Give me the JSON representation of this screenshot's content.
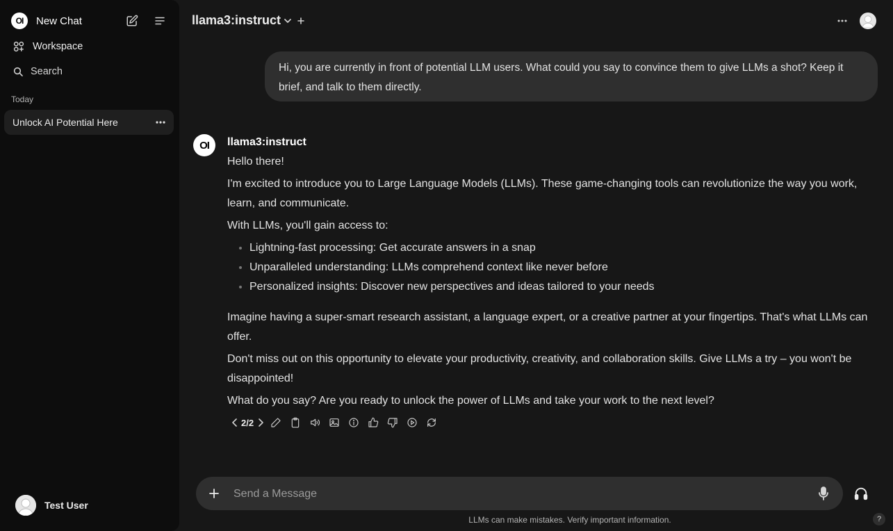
{
  "sidebar": {
    "logo_text": "OI",
    "new_chat_label": "New Chat",
    "workspace_label": "Workspace",
    "search_label": "Search",
    "section_today": "Today",
    "chats": [
      {
        "title": "Unlock AI Potential Here"
      }
    ],
    "user_name": "Test User"
  },
  "header": {
    "model_name": "llama3:instruct"
  },
  "conversation": {
    "user_message": "Hi, you are currently in front of potential LLM users. What could you say to convince them to give LLMs a shot? Keep it brief, and talk to them directly.",
    "assistant_logo_text": "OI",
    "assistant_name": "llama3:instruct",
    "paragraphs_before": [
      "Hello there!",
      "I'm excited to introduce you to Large Language Models (LLMs). These game-changing tools can revolutionize the way you work, learn, and communicate.",
      "With LLMs, you'll gain access to:"
    ],
    "bullets": [
      "Lightning-fast processing: Get accurate answers in a snap",
      "Unparalleled understanding: LLMs comprehend context like never before",
      "Personalized insights: Discover new perspectives and ideas tailored to your needs"
    ],
    "paragraphs_after": [
      "Imagine having a super-smart research assistant, a language expert, or a creative partner at your fingertips. That's what LLMs can offer.",
      "Don't miss out on this opportunity to elevate your productivity, creativity, and collaboration skills. Give LLMs a try – you won't be disappointed!",
      "What do you say? Are you ready to unlock the power of LLMs and take your work to the next level?"
    ],
    "pager": "2/2"
  },
  "composer": {
    "placeholder": "Send a Message"
  },
  "footer": {
    "disclaimer": "LLMs can make mistakes. Verify important information.",
    "help_label": "?"
  },
  "colors": {
    "background": "#171717",
    "sidebar": "#0d0d0d",
    "bubble": "#2f2f2f"
  }
}
